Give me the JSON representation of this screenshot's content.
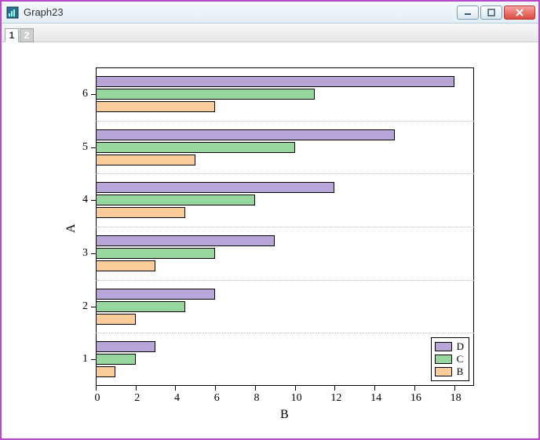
{
  "window": {
    "title": "Graph23"
  },
  "tabs": {
    "t1": "1",
    "t2": "2"
  },
  "chart_data": {
    "type": "bar",
    "orientation": "horizontal",
    "categories": [
      "1",
      "2",
      "3",
      "4",
      "5",
      "6"
    ],
    "series": [
      {
        "name": "D",
        "values": [
          3,
          6,
          9,
          12,
          15,
          18
        ],
        "color": "#b9a6d9"
      },
      {
        "name": "C",
        "values": [
          2,
          4.5,
          6,
          8,
          10,
          11
        ],
        "color": "#97d69e"
      },
      {
        "name": "B",
        "values": [
          1,
          2,
          3,
          4.5,
          5,
          6
        ],
        "color": "#fbcd9b"
      }
    ],
    "xlabel": "B",
    "ylabel": "A",
    "xlim": [
      0,
      19
    ],
    "x_ticks": [
      0,
      2,
      4,
      6,
      8,
      10,
      12,
      14,
      16,
      18
    ],
    "y_ticks": [
      "1",
      "2",
      "3",
      "4",
      "5",
      "6"
    ],
    "legend": {
      "entries": [
        "D",
        "C",
        "B"
      ],
      "position": "lower-right"
    },
    "grid": {
      "y_minor_dotted": true
    }
  }
}
